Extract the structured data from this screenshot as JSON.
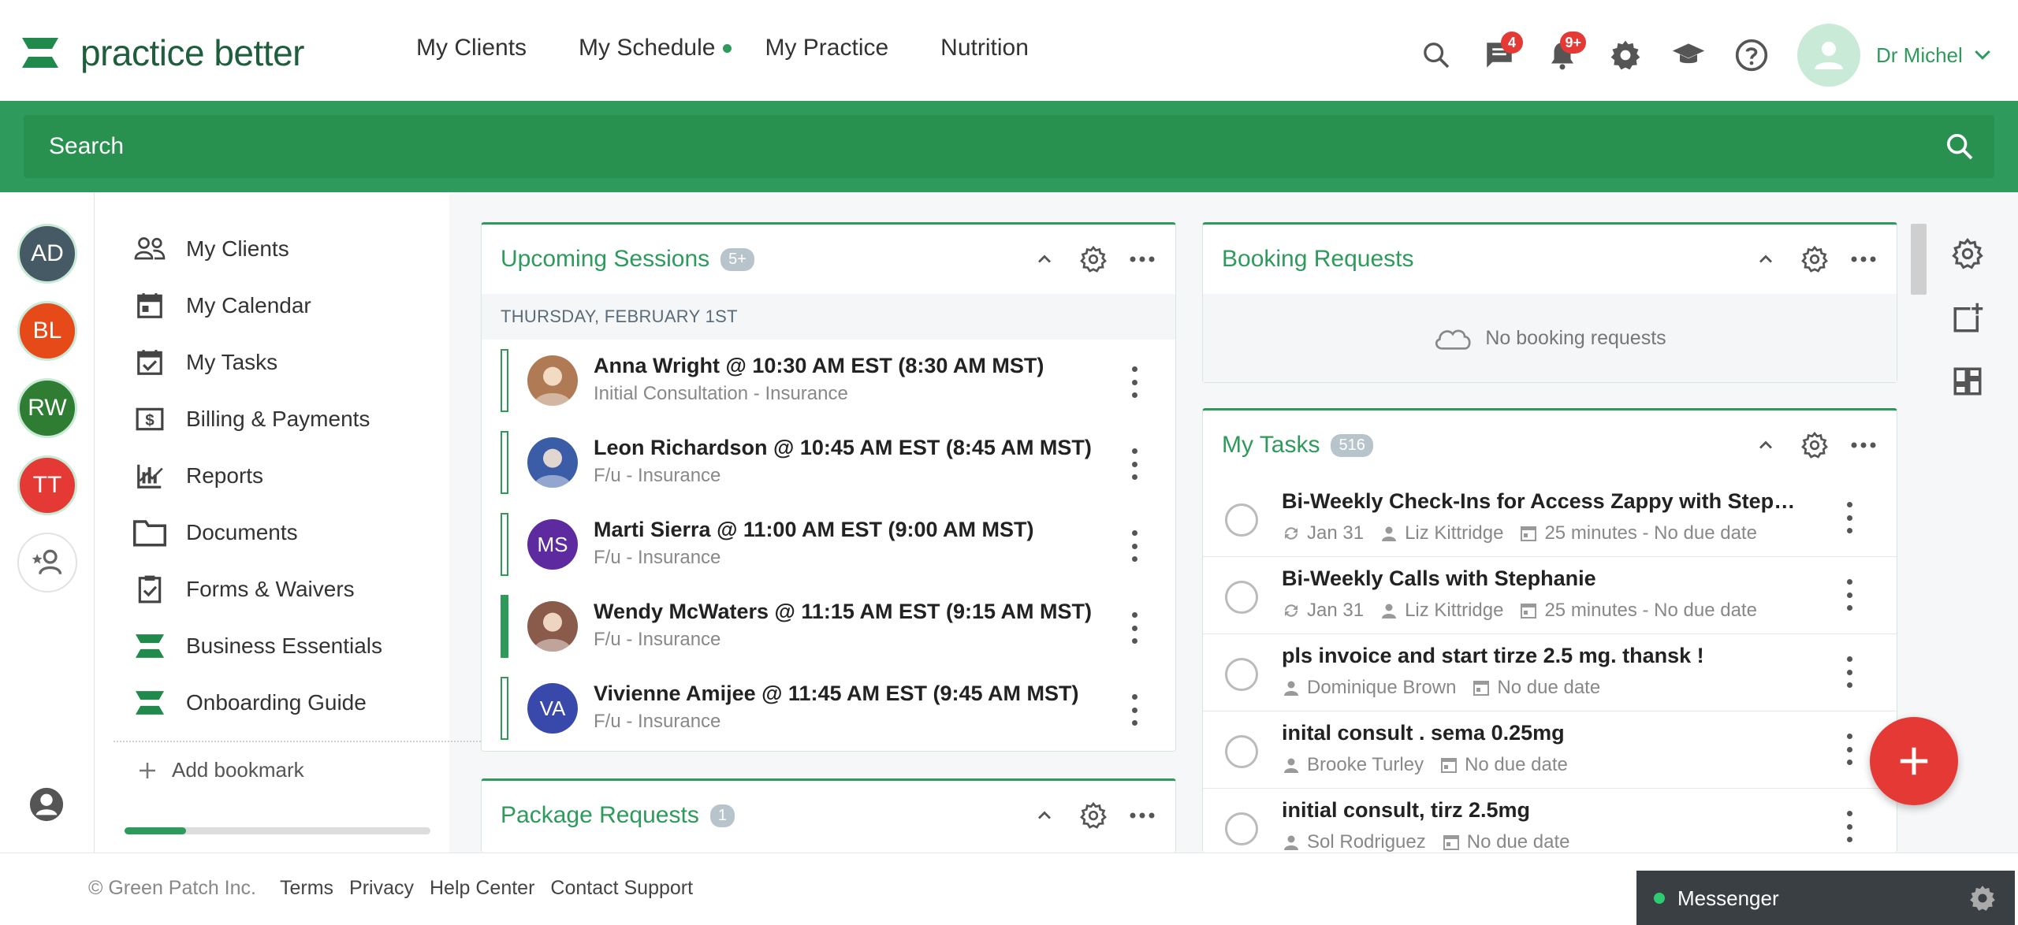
{
  "brand": {
    "name": "practice better"
  },
  "nav": {
    "links": [
      "My Clients",
      "My Schedule",
      "My Practice",
      "Nutrition"
    ]
  },
  "header": {
    "messages_badge": "4",
    "notifications_badge": "9+",
    "user_name": "Dr Michel"
  },
  "search": {
    "placeholder": "Search"
  },
  "client_rail": {
    "avatars": [
      {
        "initials": "AD",
        "color": "#455a64"
      },
      {
        "initials": "BL",
        "color": "#e64a19"
      },
      {
        "initials": "RW",
        "color": "#2e7d32"
      },
      {
        "initials": "TT",
        "color": "#e53935"
      }
    ]
  },
  "sidebar": {
    "items": [
      {
        "label": "My Clients",
        "icon": "people-icon"
      },
      {
        "label": "My Calendar",
        "icon": "calendar-icon"
      },
      {
        "label": "My Tasks",
        "icon": "task-calendar-icon"
      },
      {
        "label": "Billing & Payments",
        "icon": "billing-icon"
      },
      {
        "label": "Reports",
        "icon": "reports-icon"
      },
      {
        "label": "Documents",
        "icon": "folder-icon"
      },
      {
        "label": "Forms & Waivers",
        "icon": "clipboard-icon"
      },
      {
        "label": "Business Essentials",
        "icon": "logo-icon"
      },
      {
        "label": "Onboarding Guide",
        "icon": "logo-icon"
      }
    ],
    "add_bookmark": "Add bookmark",
    "setup_progress": 0.2
  },
  "upcoming_sessions": {
    "title": "Upcoming Sessions",
    "count": "5+",
    "day": "THURSDAY, FEBRUARY 1ST",
    "sessions": [
      {
        "title": "Anna Wright @ 10:30 AM EST (8:30 AM MST)",
        "subtitle": "Initial Consultation - Insurance",
        "initials": "",
        "color": "#b07a55",
        "solid": false
      },
      {
        "title": "Leon Richardson @ 10:45 AM EST (8:45 AM MST)",
        "subtitle": "F/u - Insurance",
        "initials": "",
        "color": "#3b5da8",
        "solid": false
      },
      {
        "title": "Marti Sierra @ 11:00 AM EST (9:00 AM MST)",
        "subtitle": "F/u - Insurance",
        "initials": "MS",
        "color": "#5e2aa0",
        "solid": false
      },
      {
        "title": "Wendy McWaters @ 11:15 AM EST (9:15 AM MST)",
        "subtitle": "F/u - Insurance",
        "initials": "",
        "color": "#8a5a4a",
        "solid": true
      },
      {
        "title": "Vivienne Amijee @ 11:45 AM EST (9:45 AM MST)",
        "subtitle": "F/u - Insurance",
        "initials": "VA",
        "color": "#3949ab",
        "solid": false
      }
    ]
  },
  "package_requests": {
    "title": "Package Requests",
    "count": "1"
  },
  "booking_requests": {
    "title": "Booking Requests",
    "empty_text": "No booking requests"
  },
  "my_tasks": {
    "title": "My Tasks",
    "count": "516",
    "tasks": [
      {
        "title": "Bi-Weekly Check-Ins for Access Zappy with Stephanie",
        "date": "Jan 31",
        "assignee": "Liz Kittridge",
        "due": "25 minutes - No due date"
      },
      {
        "title": "Bi-Weekly Calls with Stephanie",
        "date": "Jan 31",
        "assignee": "Liz Kittridge",
        "due": "25 minutes - No due date"
      },
      {
        "title": "pls invoice and start tirze 2.5 mg. thansk !",
        "date": "",
        "assignee": "Dominique Brown",
        "due": "No due date"
      },
      {
        "title": "inital consult . sema 0.25mg",
        "date": "",
        "assignee": "Brooke Turley",
        "due": "No due date"
      },
      {
        "title": "initial consult, tirz 2.5mg",
        "date": "",
        "assignee": "Sol Rodriguez",
        "due": "No due date"
      }
    ]
  },
  "footer": {
    "copyright": "© Green Patch Inc.",
    "links": [
      "Terms",
      "Privacy",
      "Help Center",
      "Contact Support"
    ]
  },
  "messenger": {
    "label": "Messenger"
  },
  "colors": {
    "brand_green": "#2e9a5c",
    "dark_green": "#1f5e3c",
    "alert_red": "#e53935"
  }
}
